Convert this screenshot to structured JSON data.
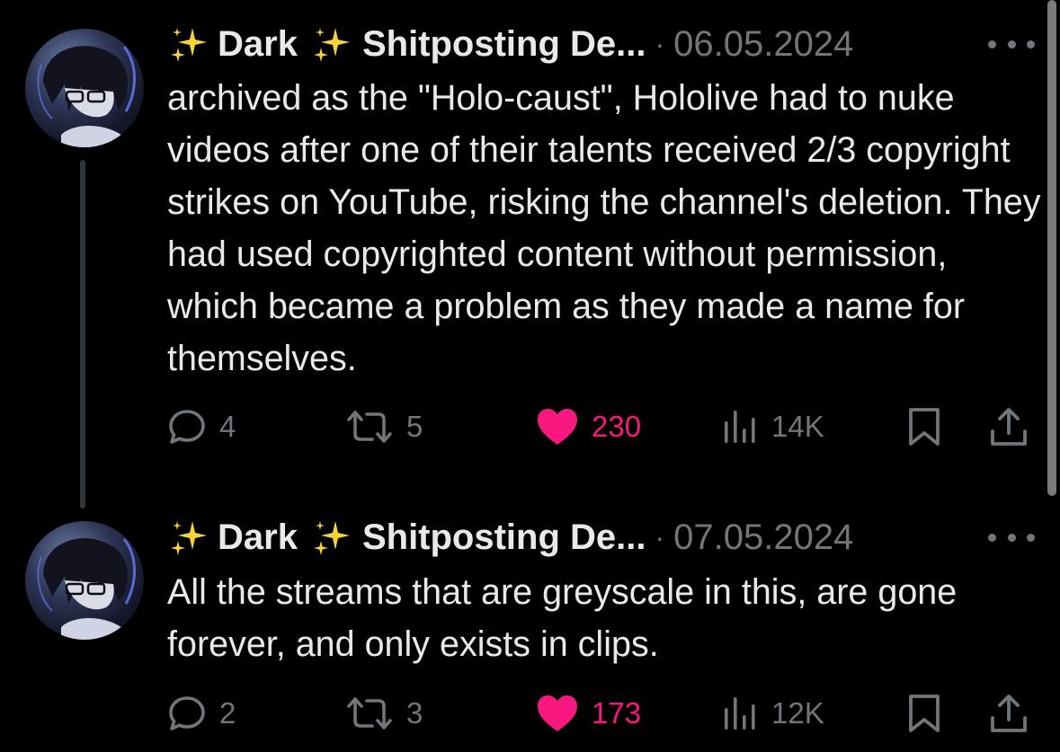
{
  "posts": [
    {
      "display_name": "Dark",
      "display_name_suffix": "Shitposting De...",
      "separator": "·",
      "date": "06.05.2024",
      "text": "archived as the \"Holo-caust\", Hololive had to nuke videos after one of their talents received 2/3 copyright strikes on YouTube, risking the channel's deletion. They had used copyrighted content without permission, which became a problem as they made a name for themselves.",
      "replies": "4",
      "reposts": "5",
      "likes": "230",
      "views": "14K"
    },
    {
      "display_name": "Dark",
      "display_name_suffix": "Shitposting De...",
      "separator": "·",
      "date": "07.05.2024",
      "text": "All the streams that are greyscale in this, are gone forever, and only exists in clips.",
      "replies": "2",
      "reposts": "3",
      "likes": "173",
      "views": "12K"
    }
  ],
  "icons": {
    "sparkle": "sparkles-icon",
    "more": "more-icon",
    "reply": "reply-icon",
    "repost": "repost-icon",
    "like": "heart-icon",
    "views": "views-icon",
    "bookmark": "bookmark-icon",
    "share": "share-icon"
  },
  "colors": {
    "background": "#000000",
    "text": "#e7e9ea",
    "muted": "#71767b",
    "like": "#f91880",
    "sparkle": "#f5d33f"
  }
}
